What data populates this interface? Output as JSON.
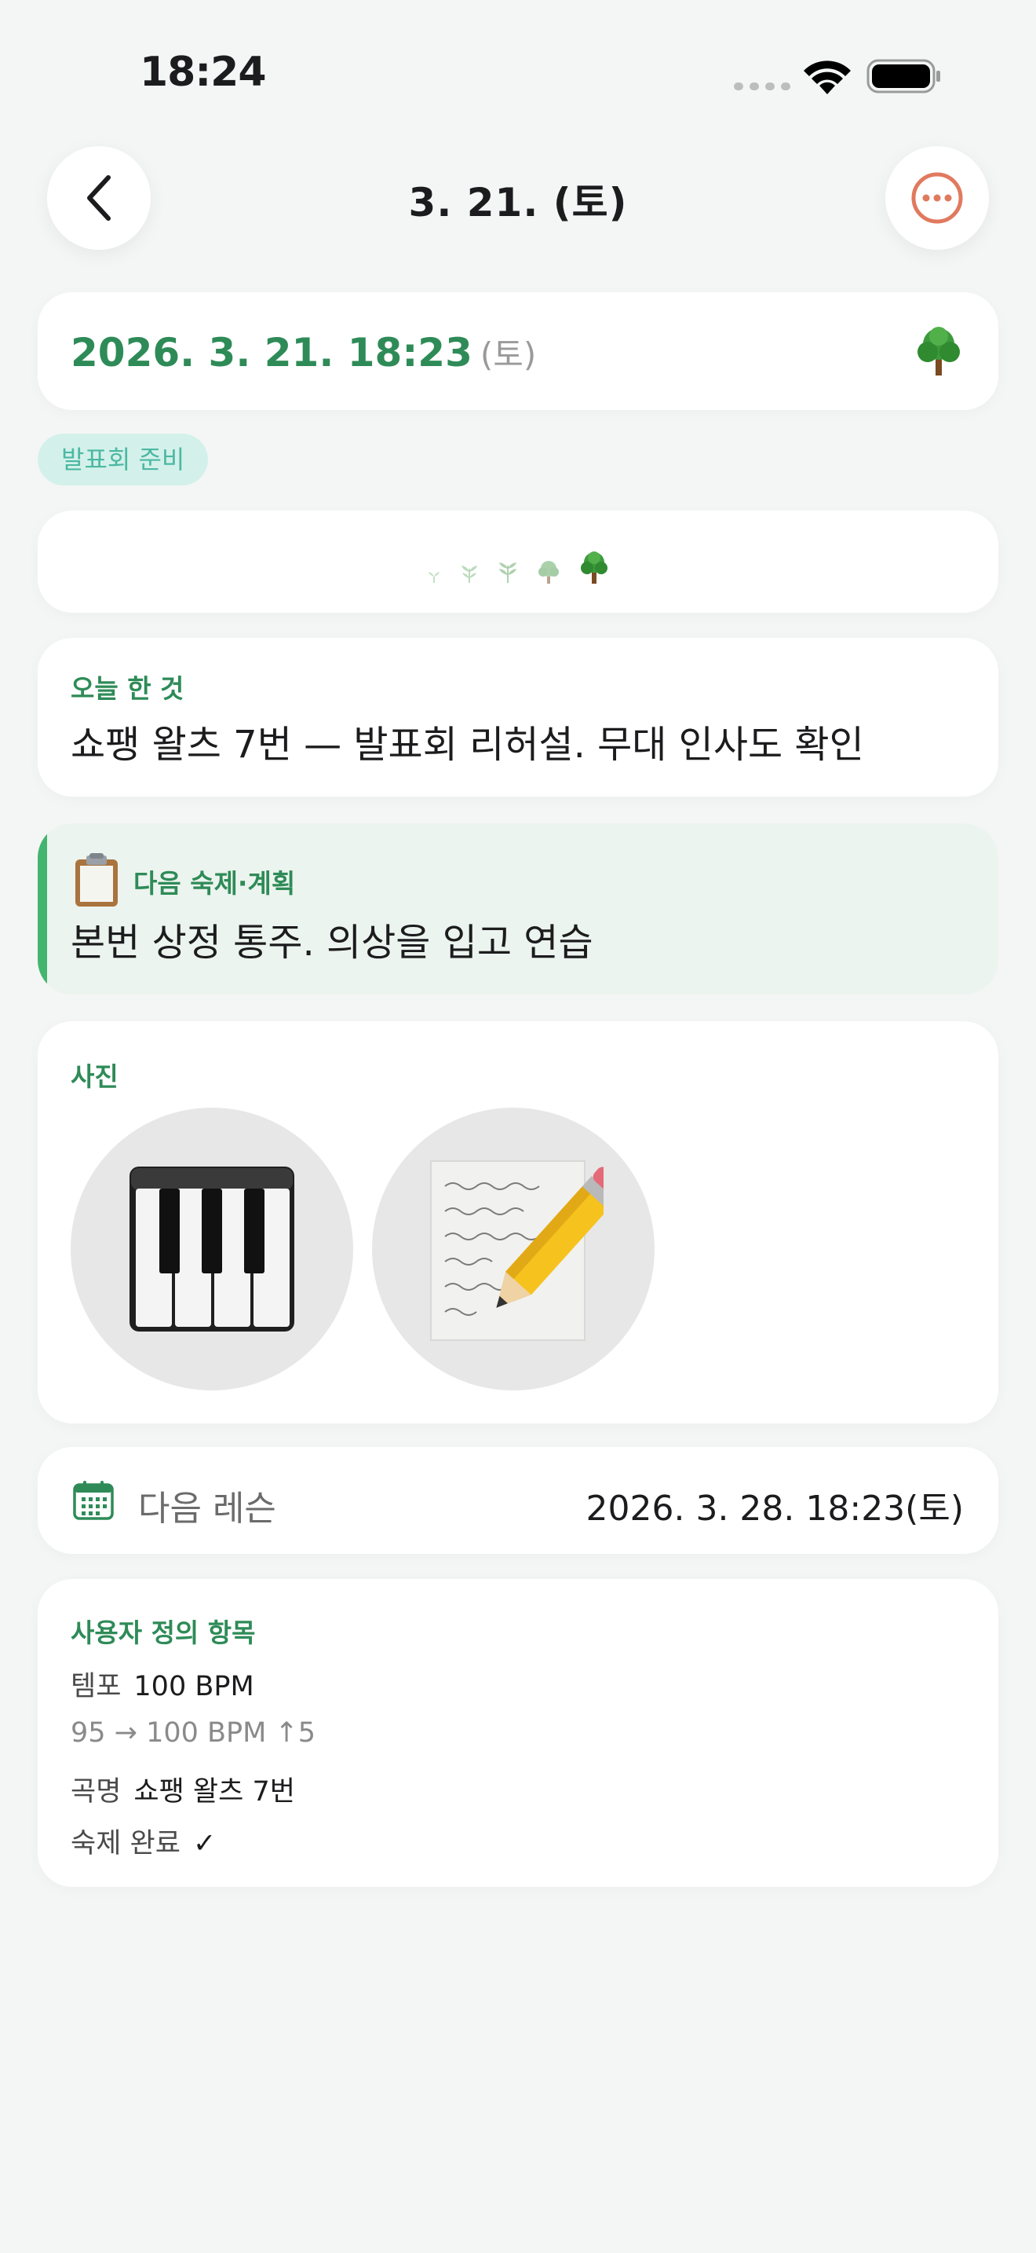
{
  "status_bar": {
    "time": "18:24"
  },
  "nav": {
    "title": "3. 21. (토)",
    "back_icon": "chevron-left-icon",
    "more_icon": "ellipsis-circle-icon",
    "accent": "#e07a5f"
  },
  "date_card": {
    "datetime": "2026. 3. 21. 18:23",
    "weekday": "(토)",
    "icon": "tree-icon"
  },
  "tag": {
    "label": "발표회 준비"
  },
  "growth": {
    "stages": [
      "seedling",
      "sprout",
      "plant",
      "young-tree",
      "tree"
    ],
    "current_stage": 5
  },
  "done": {
    "label": "오늘 한 것",
    "text": "쇼팽 왈츠 7번 — 발표회 리허설. 무대 인사도 확인"
  },
  "plan": {
    "icon": "clipboard-icon",
    "label": "다음 숙제·계획",
    "text": "본번 상정 통주. 의상을 입고 연습"
  },
  "photos": {
    "label": "사진",
    "items": [
      {
        "icon": "piano-keys-icon"
      },
      {
        "icon": "pencil-and-paper-icon"
      }
    ]
  },
  "next_lesson": {
    "icon": "calendar-icon",
    "label": "다음 레슨",
    "value": "2026. 3. 28. 18:23(토)"
  },
  "custom": {
    "label": "사용자 정의 항목",
    "tempo_key": "템포",
    "tempo_value": "100 BPM",
    "tempo_change": "95 → 100 BPM  ↑5",
    "title_key": "곡명",
    "title_value": "쇼팽 왈츠 7번",
    "homework_key": "숙제 완료",
    "homework_value": "✓"
  },
  "colors": {
    "primary_green": "#2e8b57",
    "background": "#f4f6f5",
    "tag_bg": "#d3f1ea",
    "tag_text": "#4cb8a3",
    "plan_bg": "#ecf4ef",
    "plan_bar": "#44b56f"
  }
}
